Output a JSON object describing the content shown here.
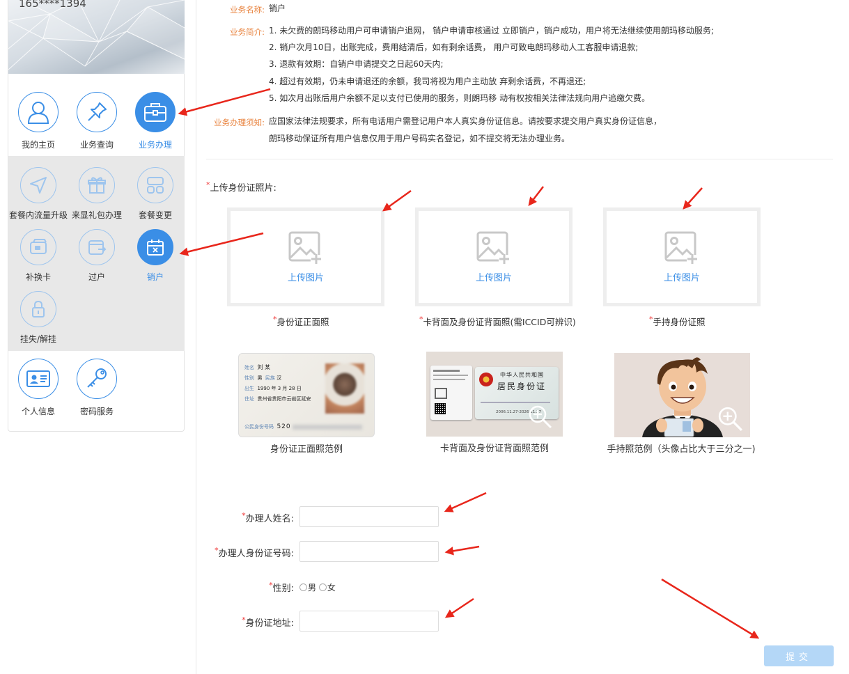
{
  "user": {
    "phone": "165****1394"
  },
  "nav": {
    "top": [
      {
        "label": "我的主页",
        "icon": "user-icon"
      },
      {
        "label": "业务查询",
        "icon": "pin-icon"
      },
      {
        "label": "业务办理",
        "icon": "briefcase-icon",
        "active": true
      }
    ],
    "sub": [
      {
        "label": "套餐内流量升级",
        "icon": "send-icon"
      },
      {
        "label": "来显礼包办理",
        "icon": "gift-icon"
      },
      {
        "label": "套餐变更",
        "icon": "layout-icon"
      },
      {
        "label": "补换卡",
        "icon": "card-icon"
      },
      {
        "label": "过户",
        "icon": "transfer-icon"
      },
      {
        "label": "销户",
        "icon": "calendar-cancel-icon",
        "active": true
      },
      {
        "label": "挂失/解挂",
        "icon": "lock-icon"
      }
    ],
    "bottom": [
      {
        "label": "个人信息",
        "icon": "id-card-icon"
      },
      {
        "label": "密码服务",
        "icon": "key-icon"
      }
    ]
  },
  "business": {
    "name_key": "业务名称:",
    "name_value": "销户",
    "intro_key": "业务简介:",
    "intro_lines": [
      "1. 未欠费的朗玛移动用户可申请销户退网， 销户申请审核通过 立即销户，销户成功，用户将无法继续使用朗玛移动服务;",
      "2. 销户次月10日，出账完成，费用结清后，如有剩余话费， 用户可致电朗玛移动人工客服申请退款;",
      "3. 退款有效期：自销户申请提交之日起60天内;",
      "4. 超过有效期，仍未申请退还的余额，我司将视为用户主动放 弃剩余话费，不再退还;",
      "5. 如次月出账后用户余额不足以支付已使用的服务，则朗玛移 动有权按相关法律法规向用户追缴欠费。"
    ],
    "notice_key": "业务办理须知:",
    "notice_lines": [
      "应国家法律法规要求，所有电话用户需登记用户本人真实身份证信息。请按要求提交用户真实身份证信息，",
      "朗玛移动保证所有用户信息仅用于用户号码实名登记，如不提交将无法办理业务。"
    ]
  },
  "upload": {
    "section_label": "上传身份证照片:",
    "required_mark": "*",
    "button_text": "上传图片",
    "slots": [
      {
        "caption": "身份证正面照"
      },
      {
        "caption": "卡背面及身份证背面照(需ICCID可辨识)"
      },
      {
        "caption": "手持身份证照"
      }
    ]
  },
  "examples": {
    "front": {
      "caption": "身份证正面照范例",
      "name_key": "姓名",
      "name_val": "刘 某",
      "sex_key": "性别",
      "sex_val": "男",
      "nation_key": "民族",
      "nation_val": "汉",
      "birth_key": "出生",
      "birth_val": "1990 年 3 月 28 日",
      "addr_key": "住址",
      "addr_val": "贵州省贵阳市云岩区延安",
      "id_key": "公民身份号码",
      "id_val": "520"
    },
    "back": {
      "caption": "卡背面及身份证背面照范例",
      "country": "中华人民共和国",
      "title": "居民身份证",
      "validity": "2006.11.27-2026.11.27"
    },
    "hand": {
      "caption": "手持照范例（头像占比大于三分之一)"
    }
  },
  "form": {
    "name_label": "办理人姓名:",
    "id_label": "办理人身份证号码:",
    "gender_label": "性别:",
    "gender_male": "男",
    "gender_female": "女",
    "address_label": "身份证地址:",
    "submit_label": "提交"
  },
  "colors": {
    "accent": "#3a8ee6",
    "key_orange": "#e8803a",
    "required_red": "#e33",
    "submit_disabled": "#b4d7f7",
    "annotation_arrow": "#e8261b"
  }
}
